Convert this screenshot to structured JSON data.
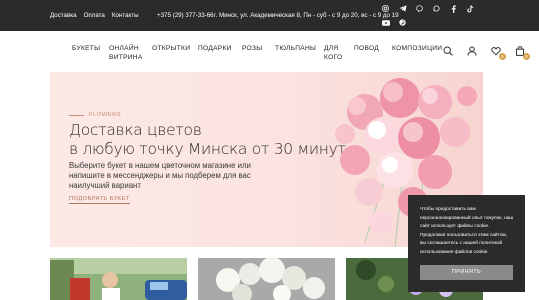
{
  "topbar": {
    "links": [
      "Доставка",
      "Оплата",
      "Контакты"
    ],
    "phone": "+375 (29) 377-33-66",
    "address": "г. Минск, ул. Академическая 8, Пн - суб - с 9 до 20, вс - с 9 до 19",
    "social": [
      "instagram-icon",
      "telegram-icon",
      "viber-icon",
      "whatsapp-icon",
      "facebook-icon",
      "tiktok-icon",
      "youtube-icon",
      "pinterest-icon"
    ]
  },
  "nav": {
    "items": [
      "БУКЕТЫ",
      "ОНЛАЙН ВИТРИНА",
      "ОТКРЫТКИ",
      "ПОДАРКИ",
      "РОЗЫ",
      "ТЮЛЬПАНЫ",
      "ДЛЯ КОГО",
      "ПОВОД",
      "КОМПОЗИЦИИ"
    ],
    "favorites_count": "0",
    "cart_count": "0"
  },
  "hero": {
    "eyebrow": "FLOWERS",
    "title_line1": "Доставка цветов",
    "title_line2": "в любую точку Минска от 30 минут",
    "subtitle": "Выберите букет в нашем цветочном магазине или напишите в мессенджеры и мы подберем для вас наилучший вариант",
    "cta": "ПОДОБРАТЬ БУКЕТ"
  },
  "cookie": {
    "text": "Чтобы предоставить вам персонализированный опыт покупок, наш сайт использует файлы cookie. Продолжая пользоваться этим сайтом, вы соглашаетесь с нашей политикой использования файлов cookie.",
    "button": "ПРИНЯТЬ"
  },
  "colors": {
    "topbar": "#2b2b2b",
    "accent": "#d6a24d",
    "hero_bg": "#fbe3df",
    "cta": "#b57466"
  }
}
